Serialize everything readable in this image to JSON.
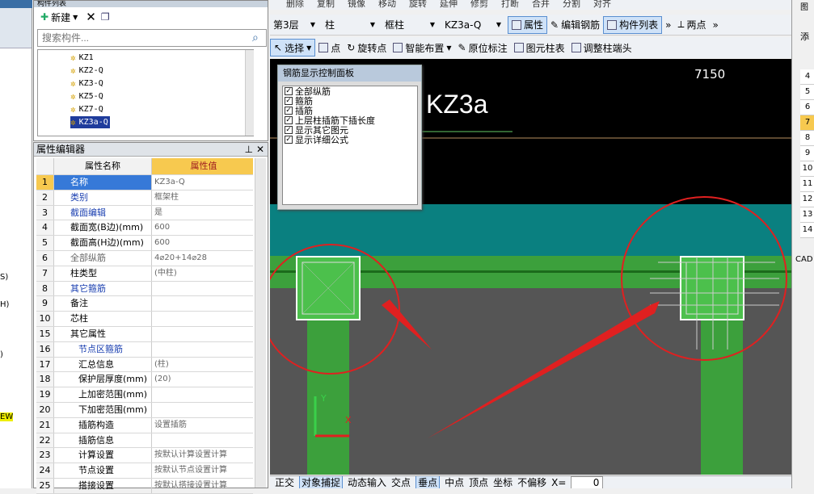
{
  "left_strip": {
    "labels": [
      "S)",
      "H)",
      ")",
      "EW"
    ]
  },
  "component_list": {
    "title": "构件列表",
    "new_label": "新建",
    "search_placeholder": "搜索构件...",
    "items": [
      "KZ1",
      "KZ2-Q",
      "KZ3-Q",
      "KZ5-Q",
      "KZ7-Q",
      "KZ3a-Q"
    ],
    "selected_item": "KZ3a-Q"
  },
  "property_editor": {
    "title": "属性编辑器",
    "col_name": "属性名称",
    "col_value": "属性值",
    "rows": [
      {
        "num": "1",
        "name": "名称",
        "value": "KZ3a-Q"
      },
      {
        "num": "2",
        "name": "类别",
        "value": "框架柱"
      },
      {
        "num": "3",
        "name": "截面编辑",
        "value": "是"
      },
      {
        "num": "4",
        "name": "截面宽(B边)(mm)",
        "value": "600"
      },
      {
        "num": "5",
        "name": "截面高(H边)(mm)",
        "value": "600"
      },
      {
        "num": "6",
        "name": "全部纵筋",
        "value": "4⌀20+14⌀28"
      },
      {
        "num": "7",
        "name": "柱类型",
        "value": "(中柱)"
      },
      {
        "num": "8",
        "name": "其它箍筋",
        "value": ""
      },
      {
        "num": "9",
        "name": "备注",
        "value": ""
      },
      {
        "num": "10",
        "name": "芯柱",
        "value": ""
      },
      {
        "num": "15",
        "name": "其它属性",
        "value": ""
      },
      {
        "num": "16",
        "name": "节点区箍筋",
        "value": ""
      },
      {
        "num": "17",
        "name": "汇总信息",
        "value": "(柱)"
      },
      {
        "num": "18",
        "name": "保护层厚度(mm)",
        "value": "(20)"
      },
      {
        "num": "19",
        "name": "上加密范围(mm)",
        "value": ""
      },
      {
        "num": "20",
        "name": "下加密范围(mm)",
        "value": ""
      },
      {
        "num": "21",
        "name": "插筋构造",
        "value": "设置插筋"
      },
      {
        "num": "22",
        "name": "插筋信息",
        "value": ""
      },
      {
        "num": "23",
        "name": "计算设置",
        "value": "按默认计算设置计算"
      },
      {
        "num": "24",
        "name": "节点设置",
        "value": "按默认节点设置计算"
      },
      {
        "num": "25",
        "name": "搭接设置",
        "value": "按默认搭接设置计算"
      }
    ]
  },
  "toolbar_top": {
    "items": [
      "删除",
      "复制",
      "镜像",
      "移动",
      "旋转",
      "延伸",
      "修剪",
      "打断",
      "合并",
      "分割",
      "对齐"
    ]
  },
  "toolbar_2": {
    "floor": "第3层",
    "category": "柱",
    "subtype": "框柱",
    "component": "KZ3a-Q",
    "properties": "属性",
    "edit_rebar": "编辑钢筋",
    "component_list": "构件列表",
    "two_points": "两点"
  },
  "toolbar_3": {
    "select": "选择",
    "point": "点",
    "rotate_point": "旋转点",
    "smart_layout": "智能布置",
    "original_label": "原位标注",
    "element_table": "图元柱表",
    "adjust_end": "调整柱端头"
  },
  "canvas": {
    "dimension": "7150",
    "column_label": "KZ3a",
    "axis_y": "Y",
    "axis_x": "X"
  },
  "rebar_panel": {
    "title": "钢筋显示控制面板",
    "options": [
      {
        "label": "全部纵筋",
        "checked": true
      },
      {
        "label": "箍筋",
        "checked": true
      },
      {
        "label": "插筋",
        "checked": true
      },
      {
        "label": "上层柱插筋下插长度",
        "checked": true
      },
      {
        "label": "显示其它图元",
        "checked": true
      },
      {
        "label": "显示详细公式",
        "checked": true
      }
    ]
  },
  "right_panel": {
    "title": "图",
    "add": "添",
    "numbers": [
      "4",
      "5",
      "6",
      "7",
      "8",
      "9",
      "10",
      "11",
      "12",
      "13",
      "14"
    ],
    "selected": "7",
    "cad": "CAD"
  },
  "status_bar": {
    "orthogonal": "正交",
    "snap": "对象捕捉",
    "dynamic_input": "动态输入",
    "intersection": "交点",
    "perpendicular": "垂点",
    "midpoint": "中点",
    "vertex": "顶点",
    "coordinate": "坐标",
    "offset": "不偏移",
    "x_label": "X=",
    "x_value": "0"
  },
  "colors": {
    "canvas_bg": "#000000",
    "teal_band": "#0a8080",
    "green_beam": "#3ca03c",
    "slab_gray": "#555555",
    "red_annotation": "#e02020"
  }
}
